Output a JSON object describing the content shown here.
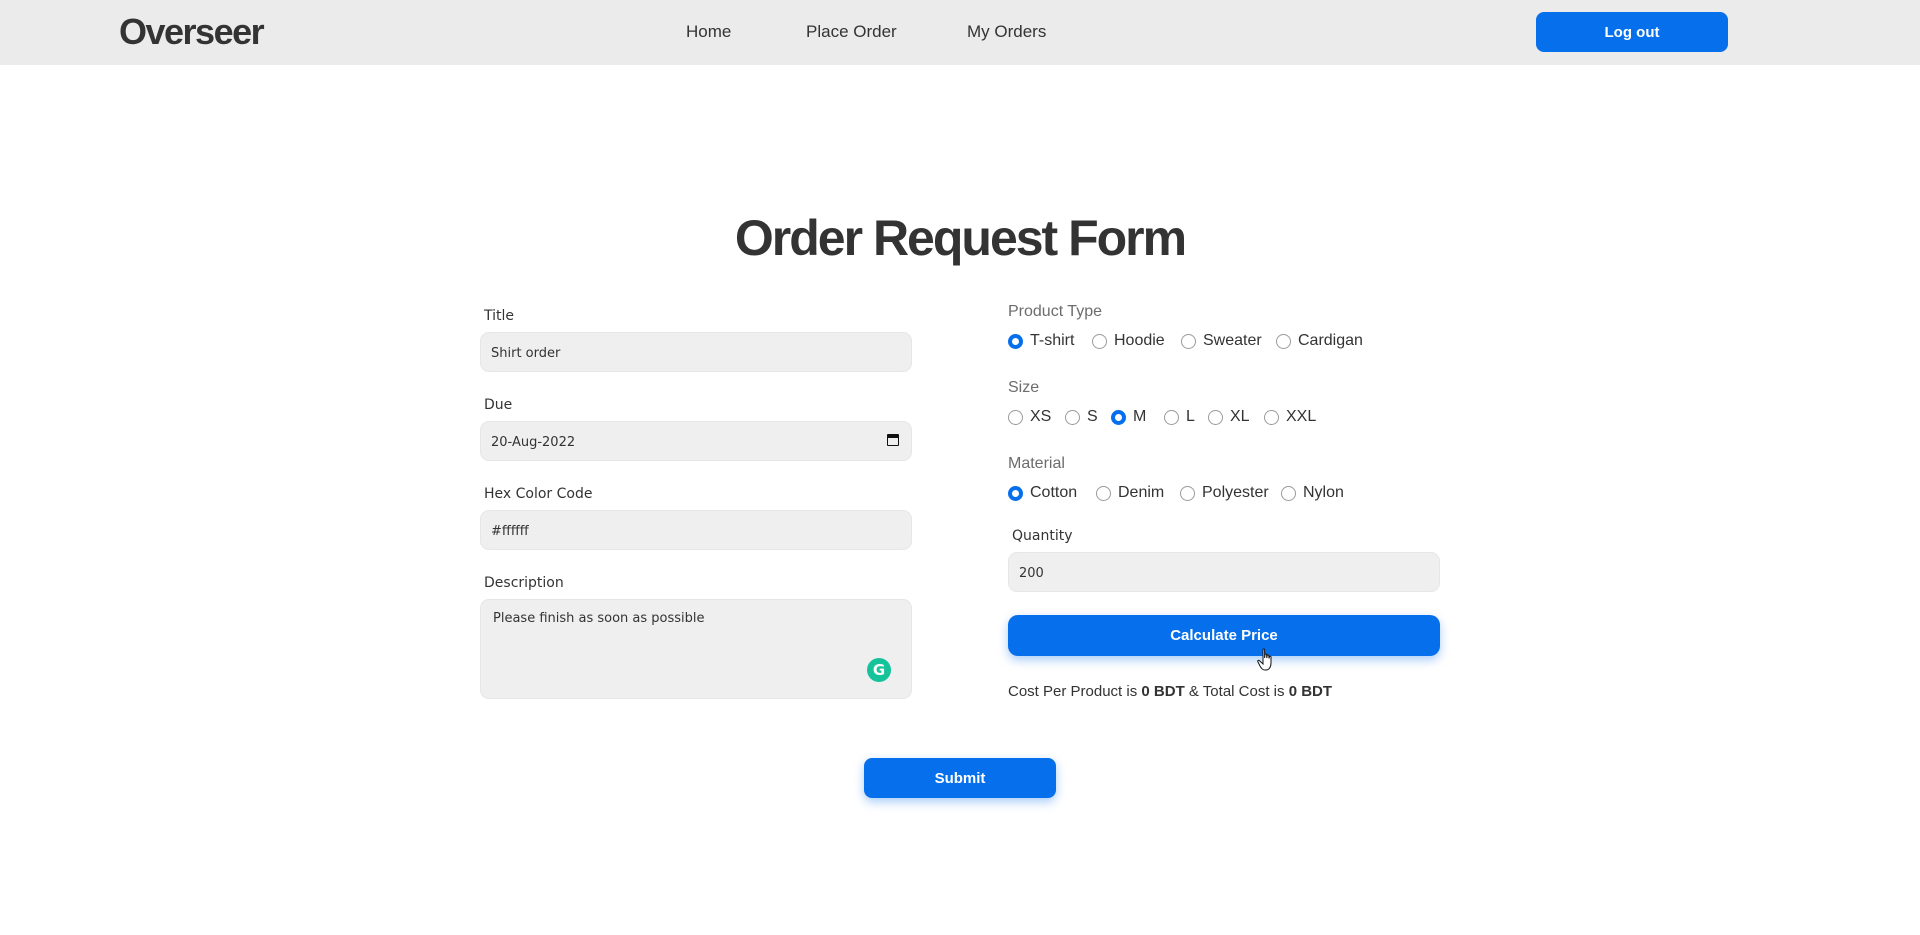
{
  "navbar": {
    "brand": "Overseer",
    "links": [
      "Home",
      "Place Order",
      "My Orders"
    ],
    "logout_label": "Log out"
  },
  "form": {
    "title": "Order Request Form",
    "title_field": {
      "label": "Title",
      "value": "Shirt order"
    },
    "due_field": {
      "label": "Due",
      "value": "20-Aug-2022"
    },
    "hex_field": {
      "label": "Hex Color Code",
      "value": "#ffffff"
    },
    "description_field": {
      "label": "Description",
      "value": "Please finish as soon as possible"
    },
    "product_type": {
      "label": "Product Type",
      "options": [
        "T-shirt",
        "Hoodie",
        "Sweater",
        "Cardigan"
      ],
      "selected": "T-shirt"
    },
    "size": {
      "label": "Size",
      "options": [
        "XS",
        "S",
        "M",
        "L",
        "XL",
        "XXL"
      ],
      "selected": "M"
    },
    "material": {
      "label": "Material",
      "options": [
        "Cotton",
        "Denim",
        "Polyester",
        "Nylon"
      ],
      "selected": "Cotton"
    },
    "quantity": {
      "label": "Quantity",
      "value": "200"
    },
    "calculate_label": "Calculate Price",
    "cost": {
      "prefix": "Cost Per Product is",
      "per_product": "0 BDT",
      "connector": "& Total Cost is",
      "total": "0 BDT"
    },
    "submit_label": "Submit"
  },
  "colors": {
    "accent": "#0670ec",
    "navbar_bg": "#ebebeb",
    "field_bg": "#efeff0"
  },
  "icons": {
    "calendar": "calendar-icon",
    "grammarly": "grammarly-icon",
    "cursor": "hand-pointer-icon"
  }
}
